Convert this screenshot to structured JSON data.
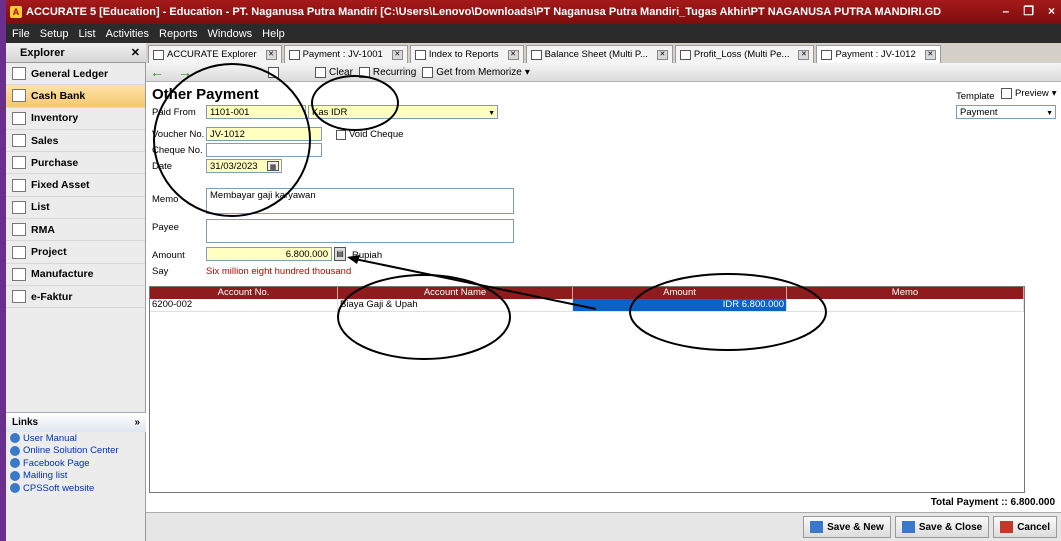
{
  "window": {
    "title": "ACCURATE 5 [Education] - Education - PT. Naganusa Putra Mandiri  [C:\\Users\\Lenovo\\Downloads\\PT Naganusa Putra Mandiri_Tugas Akhir\\PT NAGANUSA PUTRA MANDIRI.GD",
    "controls": [
      "–",
      "❐",
      "×"
    ]
  },
  "menu": [
    "File",
    "Setup",
    "List",
    "Activities",
    "Reports",
    "Windows",
    "Help"
  ],
  "explorer": {
    "title": "Explorer",
    "items": [
      {
        "label": "General Ledger",
        "icon": "ledger-icon"
      },
      {
        "label": "Cash Bank",
        "icon": "cash-bank-icon",
        "active": true
      },
      {
        "label": "Inventory",
        "icon": "inventory-icon"
      },
      {
        "label": "Sales",
        "icon": "sales-icon"
      },
      {
        "label": "Purchase",
        "icon": "purchase-icon"
      },
      {
        "label": "Fixed Asset",
        "icon": "fixed-asset-icon"
      },
      {
        "label": "List",
        "icon": "list-icon"
      },
      {
        "label": "RMA",
        "icon": "rma-icon"
      },
      {
        "label": "Project",
        "icon": "project-icon"
      },
      {
        "label": "Manufacture",
        "icon": "manufacture-icon"
      },
      {
        "label": "e-Faktur",
        "icon": "efaktur-icon"
      }
    ],
    "links_title": "Links",
    "links": [
      "User Manual",
      "Online Solution Center",
      "Facebook Page",
      "Mailing list",
      "CPSSoft website"
    ]
  },
  "tabs": [
    {
      "label": "ACCURATE Explorer"
    },
    {
      "label": "Payment : JV-1001"
    },
    {
      "label": "Index to Reports"
    },
    {
      "label": "Balance Sheet (Multi P..."
    },
    {
      "label": "Profit_Loss (Multi Pe..."
    },
    {
      "label": "Payment : JV-1012",
      "active": true
    }
  ],
  "toolbar": {
    "clear": "Clear",
    "recurring": "Recurring",
    "memorize": "Get from Memorize"
  },
  "form": {
    "title": "Other Payment",
    "template_label": "Template",
    "template_value": "Payment",
    "preview": "Preview",
    "paid_from_label": "Paid From",
    "paid_from_code": "1101-001",
    "paid_from_name": "Kas IDR",
    "voucher_label": "Voucher No.",
    "voucher_value": "JV-1012",
    "void_cheque": "Void Cheque",
    "cheque_label": "Cheque No.",
    "cheque_value": "",
    "date_label": "Date",
    "date_value": "31/03/2023",
    "memo_label": "Memo",
    "memo_value": "Membayar gaji karyawan",
    "payee_label": "Payee",
    "payee_value": "",
    "amount_label": "Amount",
    "amount_value": "6.800.000",
    "currency": "Rupiah",
    "say_label": "Say",
    "say_value": "Six million eight hundred thousand"
  },
  "grid": {
    "columns": [
      "Account No.",
      "Account Name",
      "Amount",
      "Memo"
    ],
    "rows": [
      {
        "account_no": "6200-002",
        "account_name": "Biaya Gaji & Upah",
        "amount": "IDR 6.800.000",
        "memo": ""
      }
    ]
  },
  "total": "Total Payment :: 6.800.000",
  "actions": {
    "save_new": "Save & New",
    "save_close": "Save & Close",
    "cancel": "Cancel"
  }
}
